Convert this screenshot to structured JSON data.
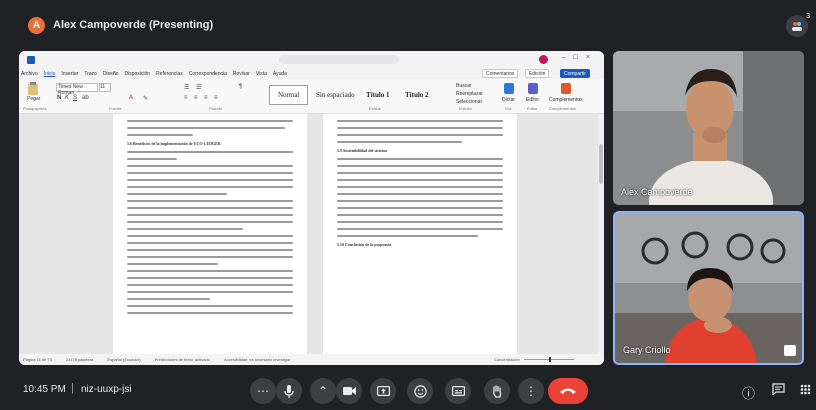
{
  "header": {
    "presenter_initial": "A",
    "presenter_title": "Alex Campoverde (Presenting)",
    "participant_count": "3"
  },
  "shared_screen": {
    "menu_items": [
      "Archivo",
      "Inicio",
      "Insertar",
      "Trazo",
      "Diseño",
      "Disposición",
      "Referencias",
      "Correspondencia",
      "Revisar",
      "Vista",
      "Ayuda"
    ],
    "active_menu": "Inicio",
    "comments_label": "Comentarios",
    "editing_label": "Edición",
    "share_label": "Compartir",
    "font_name": "Times New Roman",
    "font_size": "11",
    "paste_label": "Pegar",
    "styles": [
      "Normal",
      "Sin espaciado",
      "Título 1",
      "Título 2"
    ],
    "selected_style": "Normal",
    "find_label": "Buscar",
    "replace_label": "Reemplazar",
    "select_label": "Seleccionar",
    "dictate_label": "Dictar",
    "editor_label": "Editor",
    "addins_label": "Complementos",
    "group_labels": [
      "Portapapeles",
      "Fuente",
      "Párrafo",
      "Estilos",
      "Edición",
      "Voz",
      "Editor",
      "Complementos"
    ],
    "heading_left": "5.6 Beneficios de la implementación de ECO-LEDGER",
    "heading_right_1": "5.9 Sostenibilidad del sistema",
    "heading_right_2": "5.10 Conclusión de la propuesta",
    "status_page": "Página 11 de 73",
    "status_words": "13175 palabras",
    "status_lang": "Español (Ecuador)",
    "status_prediction": "Predicciones de texto: activado",
    "status_access": "Accesibilidad: es necesario investigar",
    "status_focus": "Concentración"
  },
  "participants": [
    {
      "name": "Alex Campoverde"
    },
    {
      "name": "Gary Criollo"
    }
  ],
  "bottom_bar": {
    "time": "10:45 PM",
    "separator": "|",
    "meeting_code": "niz-uuxp-jsi"
  },
  "colors": {
    "background": "#202124",
    "end_call": "#ea4335",
    "control": "#3c4043",
    "active_speaker_border": "#8ab4f8",
    "presenter_avatar": "#e8703a",
    "word_blue": "#185abd"
  }
}
